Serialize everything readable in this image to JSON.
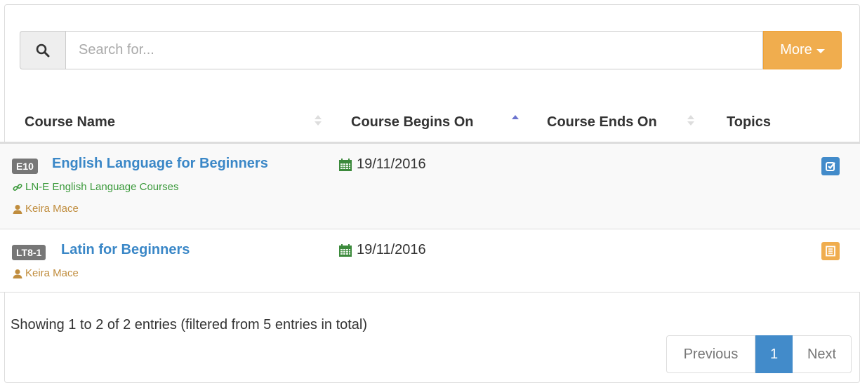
{
  "search": {
    "placeholder": "Search for...",
    "more_label": "More"
  },
  "table": {
    "columns": [
      "Course Name",
      "Course Begins On",
      "Course Ends On",
      "Topics"
    ],
    "rows": [
      {
        "code": "E10",
        "name": "English Language for Beginners",
        "group": "LN-E English Language Courses",
        "teacher": "Keira Mace",
        "begins": "19/11/2016",
        "ends": "",
        "action_icon": "check-square-icon"
      },
      {
        "code": "LT8-1",
        "name": "Latin for Beginners",
        "teacher": "Keira Mace",
        "begins": "19/11/2016",
        "ends": "",
        "action_icon": "list-alt-icon"
      }
    ]
  },
  "info": "Showing 1 to 2 of 2 entries (filtered from 5 entries in total)",
  "pagination": {
    "previous": "Previous",
    "current": "1",
    "next": "Next"
  },
  "colors": {
    "primary": "#428bca",
    "warning": "#f0ad4e",
    "success": "#3c9a3c",
    "teacher": "#c08d3e",
    "badge": "#777777"
  }
}
